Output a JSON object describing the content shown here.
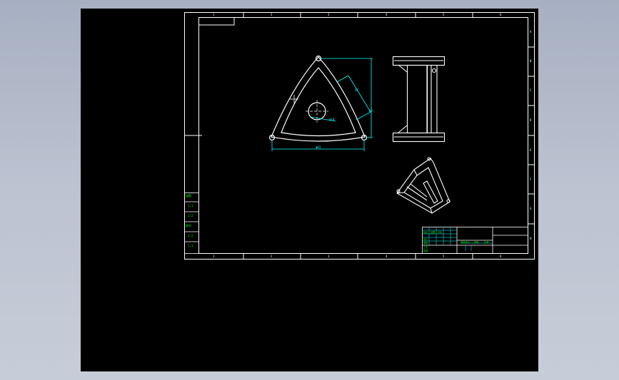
{
  "colors": {
    "background_gradient_top": "#a7b0c2",
    "background_gradient_bottom": "#c7cdd8",
    "viewport": "#000000",
    "geometry": "#ffffff",
    "dimensions": "#00ffff",
    "title_block_text": "#00ff00",
    "sidebar_text": "#00ff00"
  },
  "frame": {
    "top_zone_labels": [
      "1",
      "2",
      "3",
      "4",
      "5",
      "6"
    ],
    "bottom_zone_labels": [
      "1",
      "2",
      "3",
      "4",
      "5",
      "6"
    ],
    "right_zone_labels": [
      "A",
      "B",
      "C",
      "D",
      "E",
      "F",
      "G",
      "H"
    ]
  },
  "left_strip": {
    "rows": [
      "描图",
      "1:1",
      "1:2",
      "校对",
      "1:2",
      "1:1"
    ]
  },
  "front_view": {
    "dim_width": "φ81",
    "dim_height": "80",
    "dim_side": "45",
    "dim_hole": "φ18"
  },
  "title_block": {
    "labels": [
      "标记",
      "处数",
      "分区",
      "设计",
      "审核",
      "工艺",
      "批准"
    ],
    "scale_labels": [
      "阶段标记",
      "重量",
      "比例"
    ]
  }
}
